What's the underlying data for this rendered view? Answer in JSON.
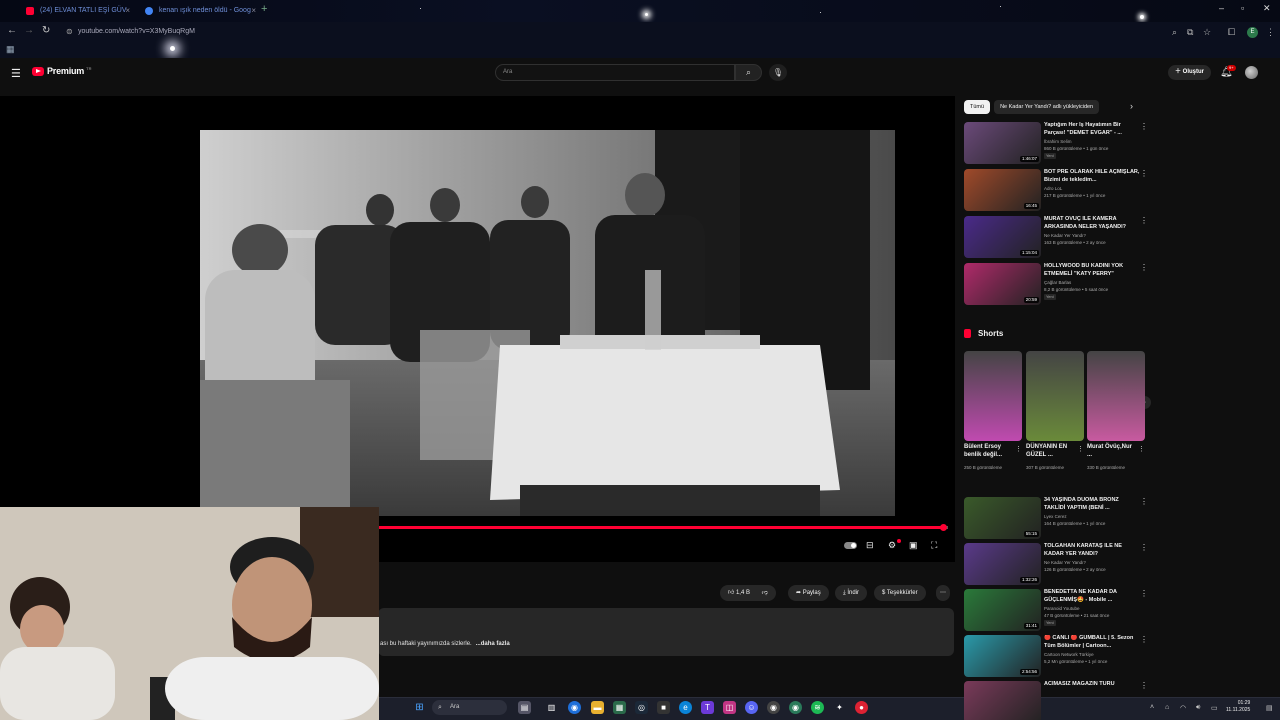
{
  "browser": {
    "tabs": [
      {
        "label": "(24) ELVAN TATLI EŞİ GÜV",
        "favicon_color": "#ff0033"
      },
      {
        "label": "kenan ışık neden öldü - Goog",
        "favicon_color": "#4285f4"
      }
    ],
    "url": "youtube.com/watch?v=X3MyBuqRgM",
    "profile_letter": "E"
  },
  "youtube": {
    "logo_text": "Premium",
    "logo_superscript": "TR",
    "search_placeholder": "Ara",
    "create_label": "Oluştur",
    "notif_count": "9+"
  },
  "player": {
    "progress_fraction": 0.996
  },
  "actions": {
    "likes": "1,4 B",
    "share": "Paylaş",
    "download": "İndir",
    "thanks": "Teşekkürler"
  },
  "description": {
    "text": "ası bu haftaki yayınımızda sizlerle.",
    "more": "...daha fazla"
  },
  "sidebar": {
    "chips": [
      "Tümü",
      "Ne Kadar Yer Yandı? adlı yükleyiciden"
    ],
    "recs_top": [
      {
        "title": "Yaptığım Her İş Hayatımın Bir Parçası! \"DEMET EVGAR\" - ...",
        "channel": "İbrahim Selim",
        "meta": "860 B görüntüleme • 1 gün önce",
        "badge": "Yeni",
        "duration": "1:46:07",
        "thumb": "#6b4a7a"
      },
      {
        "title": "BOT PRE OLARAK HİLE AÇMIŞLAR, Bizimi de tekledim...",
        "channel": "Adro LoL",
        "meta": "217 B görüntüleme • 1 yıl önce",
        "badge": "",
        "duration": "16:45",
        "thumb": "#a04a2a"
      },
      {
        "title": "MURAT ÖVÜÇ İLE KAMERA ARKASINDA NELER YAŞANDI?",
        "channel": "Ne Kadar Yer Yandı?",
        "meta": "163 B görüntüleme • 2 ay önce",
        "badge": "",
        "duration": "1:15:04",
        "thumb": "#4a2a8a"
      },
      {
        "title": "HOLLYWOOD BU KADINI YOK ETMEMELİ \"KATY PERRY\"",
        "channel": "Çağlar Barlas",
        "meta": "8,2 B görüntüleme • 5 saat önce",
        "badge": "Yeni",
        "duration": "20:59",
        "thumb": "#b02a6a"
      }
    ],
    "shorts_header": "Shorts",
    "shorts": [
      {
        "title": "Bülent Ersoy benlik değil...",
        "views": "250 B görüntüleme",
        "thumb": "#c04ab0"
      },
      {
        "title": "DÜNYANIN EN GÜZEL ...",
        "views": "307 B görüntüleme",
        "thumb": "#6a8a3a"
      },
      {
        "title": "Murat Övüç,Nur ...",
        "views": "330 B görüntüleme",
        "thumb": "#c85aa0"
      }
    ],
    "recs_bottom": [
      {
        "title": "34 YAŞINDA DUOMA BRONZ TAKLİDİ YAPTIM (BENİ ...",
        "channel": "Lyex Cerez",
        "meta": "164 B görüntüleme • 1 yıl önce",
        "badge": "",
        "duration": "55:15",
        "thumb": "#3a5a2a"
      },
      {
        "title": "TOLGAHAN KARATAŞ İLE NE KADAR YER YANDI?",
        "channel": "Ne Kadar Yer Yandı?",
        "meta": "126 B görüntüleme • 2 ay önce",
        "badge": "",
        "duration": "1:32:26",
        "thumb": "#5a3a8a"
      },
      {
        "title": "BENEDETTA NE KADAR DA GÜÇLENMİŞ🤩 - Mobile ...",
        "channel": "Paranoid Youtube",
        "meta": "47 B görüntüleme • 21 saat önce",
        "badge": "Yeni",
        "duration": "31:41",
        "thumb": "#2a7a3a"
      },
      {
        "title": "🔴 CANLI 🔴 GUMBALL | 5. Sezon Tüm Bölümler | Cartoon...",
        "channel": "Cartoon Network Türkiye",
        "meta": "5,2 Mn görüntüleme • 1 yıl önce",
        "badge": "",
        "duration": "2:54:56",
        "thumb": "#2a9aaa"
      },
      {
        "title": "ACIMASIZ MAGAZİN TURU",
        "channel": "",
        "meta": "",
        "badge": "",
        "duration": "",
        "thumb": "#7a3a5a"
      }
    ]
  },
  "taskbar": {
    "search_label": "Ara",
    "time": "01:29",
    "date": "11.11.2025"
  }
}
